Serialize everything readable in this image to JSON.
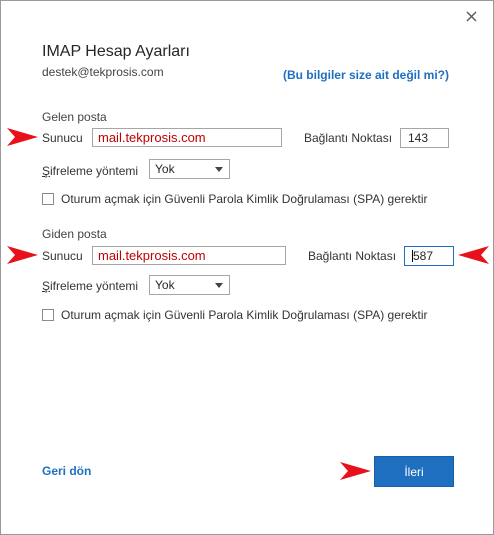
{
  "dialog": {
    "title": "IMAP Hesap Ayarları",
    "email": "destek@tekprosis.com",
    "not_me_link": "(Bu bilgiler size ait değil mi?)"
  },
  "incoming": {
    "section_label": "Gelen posta",
    "server_label": "Sunucu",
    "server_value": "mail.tekprosis.com",
    "port_label": "Bağlantı Noktası",
    "port_value": "143",
    "encryption_label_first": "Ş",
    "encryption_label_rest": "ifreleme yöntemi",
    "encryption_value": "Yok",
    "spa_label": "Oturum açmak için Güvenli Parola Kimlik Doğrulaması (SPA) gerektir",
    "spa_checked": false
  },
  "outgoing": {
    "section_label": "Giden posta",
    "server_label": "Sunucu",
    "server_value": "mail.tekprosis.com",
    "port_label": "Bağlantı Noktası",
    "port_value": "587",
    "encryption_label_first": "Ş",
    "encryption_label_rest": "ifreleme yöntemi",
    "encryption_value": "Yok",
    "spa_label": "Oturum açmak için Güvenli Parola Kimlik Doğrulaması (SPA) gerektir",
    "spa_checked": false
  },
  "footer": {
    "back_label": "Geri dön",
    "next_label": "İleri"
  },
  "icons": {
    "close": "close-icon",
    "annotation": "red-arrow-icon",
    "dropdown": "chevron-down-icon"
  },
  "colors": {
    "accent": "#1e6fc0",
    "annotation_red": "#e8101a",
    "server_text": "#c00000"
  }
}
